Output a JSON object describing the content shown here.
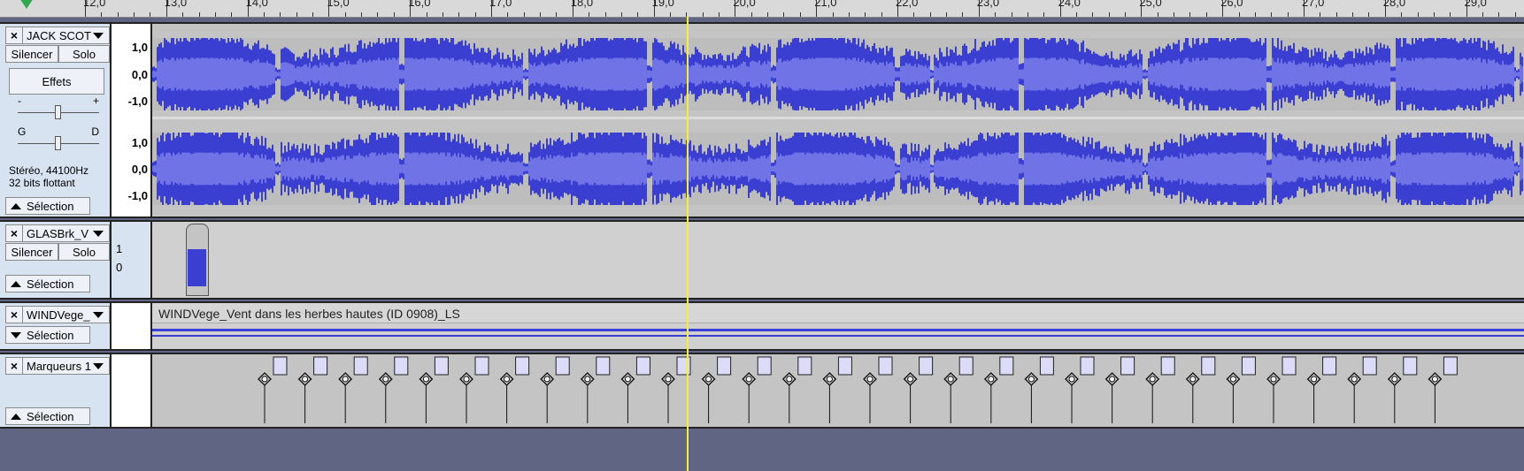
{
  "ruler": {
    "ticks": [
      "12,0",
      "13,0",
      "14,0",
      "15,0",
      "16,0",
      "17,0",
      "18,0",
      "19,0",
      "20,0",
      "21,0",
      "22,0",
      "23,0",
      "24,0",
      "25,0",
      "26,0",
      "27,0",
      "28,0",
      "29,0"
    ]
  },
  "tracks": {
    "jack": {
      "name": "JACK SCOT",
      "mute": "Silencer",
      "solo": "Solo",
      "effects": "Effets",
      "gain_minus": "-",
      "gain_plus": "+",
      "pan_left": "G",
      "pan_right": "D",
      "format": "Stéréo, 44100Hz",
      "bits": "32 bits flottant",
      "select": "Sélection",
      "scale_top": "1,0",
      "scale_mid": "0,0",
      "scale_bot": "-1,0",
      "waveform_color": "#3b3fd1"
    },
    "glas": {
      "name": "GLASBrk_V",
      "mute": "Silencer",
      "solo": "Solo",
      "select": "Sélection",
      "scale_top": "1",
      "scale_bot": "0"
    },
    "wind": {
      "name": "WINDVege_",
      "select": "Sélection",
      "clip_title": "WINDVege_Vent dans les herbes hautes (ID 0908)_LS"
    },
    "markers": {
      "name": "Marqueurs 1",
      "select": "Sélection",
      "count": 30
    }
  },
  "colors": {
    "cursor": "#f5f036",
    "background": "#5f6582",
    "panel": "#d8e3f2"
  }
}
